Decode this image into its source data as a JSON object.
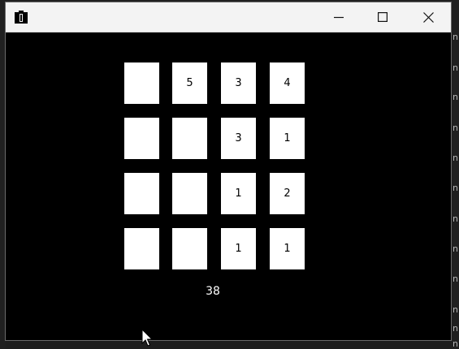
{
  "background_right_glyphs": [
    "n",
    "n",
    "n",
    "n",
    "n",
    "n",
    "n",
    "n",
    "n",
    "n",
    "n",
    "n"
  ],
  "window": {
    "title": "",
    "icons": {
      "app": "app-icon",
      "minimize": "minimize-icon",
      "maximize": "maximize-icon",
      "close": "close-icon"
    }
  },
  "board": {
    "rows": [
      [
        "",
        "5",
        "3",
        "4"
      ],
      [
        "",
        "",
        "3",
        "1"
      ],
      [
        "",
        "",
        "1",
        "2"
      ],
      [
        "",
        "",
        "1",
        "1"
      ]
    ]
  },
  "score": "38",
  "colors": {
    "tile": "#ffffff",
    "background": "#000000",
    "titlebar": "#f3f3f3"
  }
}
